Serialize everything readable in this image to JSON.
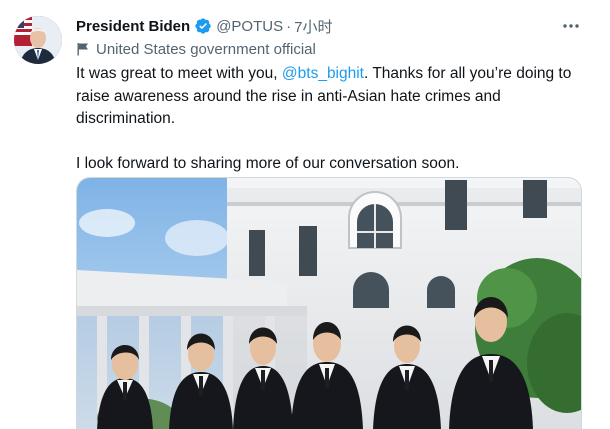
{
  "tweet": {
    "display_name": "President Biden",
    "handle": "@POTUS",
    "separator": "·",
    "time": "7小时",
    "gov_label": "United States government official",
    "text": {
      "line1_before": "It was great to meet with you, ",
      "mention": "@bts_bighit",
      "line1_after": ". Thanks for all you’re doing to raise awareness around the rise in anti-Asian hate crimes and discrimination.",
      "paragraph2": "I look forward to sharing more of our conversation soon."
    },
    "icons": {
      "verified": "verified-badge-icon",
      "more": "more-options-icon",
      "gov": "government-flag-icon"
    },
    "colors": {
      "link": "#1d9bf0",
      "secondary_text": "#536471",
      "primary_text": "#0f1419",
      "verified": "#1d9bf0"
    }
  }
}
